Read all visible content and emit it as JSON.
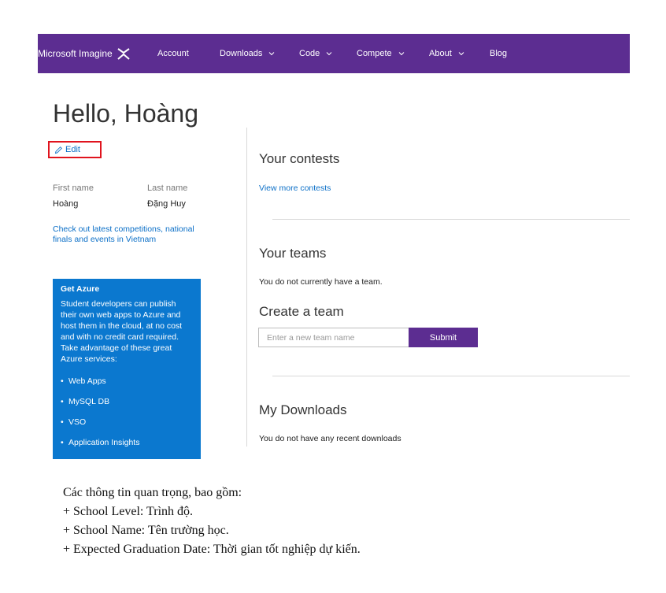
{
  "nav": {
    "brand": "Microsoft Imagine",
    "items": [
      {
        "label": "Account",
        "dropdown": false
      },
      {
        "label": "Downloads",
        "dropdown": true
      },
      {
        "label": "Code",
        "dropdown": true
      },
      {
        "label": "Compete",
        "dropdown": true
      },
      {
        "label": "About",
        "dropdown": true
      },
      {
        "label": "Blog",
        "dropdown": false
      }
    ],
    "color": "#5c2d91"
  },
  "profile": {
    "greeting": "Hello, Hoàng",
    "edit_label": "Edit",
    "first_name_label": "First name",
    "last_name_label": "Last name",
    "first_name": "Hoàng",
    "last_name": "Đặng Huy",
    "events_link": "Check out latest competitions, national finals and events in Vietnam"
  },
  "azure": {
    "title": "Get Azure",
    "body": "Student developers can publish their own web apps to Azure and host them in the cloud, at no cost and with no credit card required. Take advantage of these great Azure services:",
    "services": [
      "Web Apps",
      "MySQL DB",
      "VSO",
      "Application Insights"
    ],
    "color": "#0b78cf"
  },
  "contests": {
    "title": "Your contests",
    "link": "View more contests"
  },
  "teams": {
    "title": "Your teams",
    "empty": "You do not currently have a team.",
    "create_title": "Create a team",
    "input_placeholder": "Enter a new team name",
    "input_value": "",
    "submit_label": "Submit"
  },
  "downloads": {
    "title": "My Downloads",
    "empty": "You do not have any recent downloads"
  },
  "notes": [
    "Các thông tin quan trọng, bao gồm:",
    "+ School Level: Trình độ.",
    "+ School Name: Tên trường học.",
    "+ Expected Graduation Date: Thời gian tốt nghiệp dự kiến."
  ],
  "accent_link_color": "#0b6fc7",
  "highlight_color": "#e0141e"
}
